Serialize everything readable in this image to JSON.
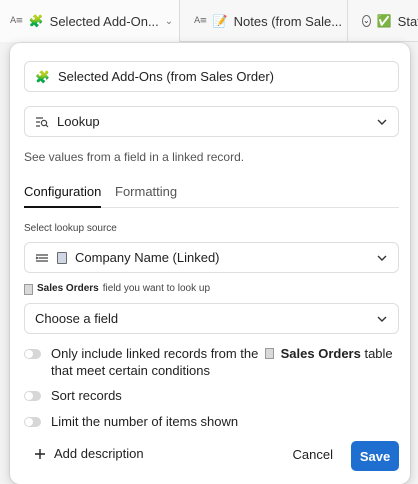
{
  "columns": [
    {
      "type_icon": "A≡",
      "emoji": "🧩",
      "label": "Selected Add-On...",
      "selected": true
    },
    {
      "type_icon": "A≡",
      "emoji": "📝",
      "label": "Notes (from Sale...",
      "selected": false
    },
    {
      "type_icon": "⌄",
      "emoji": "✅",
      "label": "Statu",
      "selected": false
    }
  ],
  "dialog": {
    "field_name": "Selected Add-Ons (from Sales Order)",
    "field_emoji": "🧩",
    "field_type": "Lookup",
    "field_type_icon": "lookup-icon",
    "help_text": "See values from a field in a linked record.",
    "tabs": [
      "Configuration",
      "Formatting"
    ],
    "active_tab": "Configuration",
    "lookup_source_label": "Select lookup source",
    "lookup_source_value": "Company Name (Linked)",
    "field_prompt_table": "Sales Orders",
    "field_prompt_suffix": "field you want to look up",
    "field_select_value": "Choose a field",
    "options": [
      {
        "prefix": "Only include linked records from the",
        "table": "Sales Orders",
        "suffix": "table that meet certain conditions",
        "enabled": false
      },
      {
        "label": "Sort records",
        "enabled": false
      },
      {
        "label": "Limit the number of items shown",
        "enabled": false
      }
    ],
    "add_description_label": "Add description",
    "cancel_label": "Cancel",
    "save_label": "Save",
    "colors": {
      "save": "#1f6fd1",
      "toggle_off": "#d7d7d7"
    }
  }
}
